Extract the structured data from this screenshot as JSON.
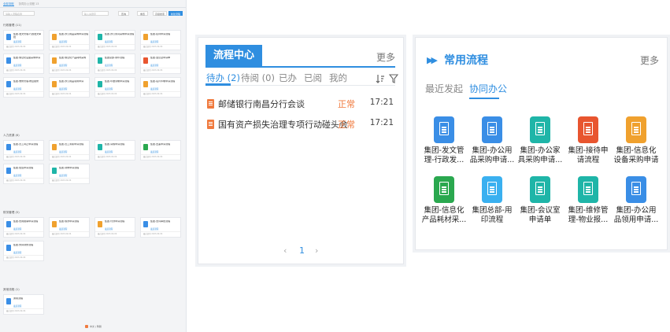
{
  "left_panel": {
    "tabs": [
      "全部流程",
      "协同办公流程 13"
    ],
    "search_placeholder": "请输入流程名称",
    "search2_placeholder": "输入关键字",
    "btn_query": "查询",
    "btn_reset": "重置",
    "btn_advanced": "高级搜索",
    "btn_new": "新建流程",
    "sections": [
      {
        "title": "行政管理 (11)",
        "cards": [
          {
            "title": "集团-发文管理-行政发文审批",
            "color": "#3a8ee6"
          },
          {
            "title": "集团-办公用品采购申请流程",
            "color": "#f0a12e"
          },
          {
            "title": "集团-办公家具采购申请流程",
            "color": "#1fb5a8"
          },
          {
            "title": "集团-接待申请流程",
            "color": "#f0a12e"
          },
          {
            "title": "集团-信息化设备采购申请",
            "color": "#3a8ee6"
          },
          {
            "title": "集团-信息化产品耗材采购",
            "color": "#f0a12e"
          },
          {
            "title": "集团总部-用印流程",
            "color": "#1fb5a8"
          },
          {
            "title": "集团-会议室申请单",
            "color": "#e8552f"
          },
          {
            "title": "集团-维修管理-物业报修",
            "color": "#3a8ee6"
          },
          {
            "title": "集团-办公用品领用申请",
            "color": "#f0a12e"
          },
          {
            "title": "集团-印章刻制申请流程",
            "color": "#1fb5a8"
          },
          {
            "title": "集团-名片印制申请流程",
            "color": "#f0a12e"
          }
        ]
      },
      {
        "title": "人力资源 (6)",
        "cards": [
          {
            "title": "集团-员工转正申请流程",
            "color": "#3a8ee6"
          },
          {
            "title": "集团-员工离职申请流程",
            "color": "#f0a12e"
          },
          {
            "title": "集团-请假申请流程",
            "color": "#1fb5a8"
          },
          {
            "title": "集团-出差申请流程",
            "color": "#2aa84f"
          },
          {
            "title": "集团-加班申请流程",
            "color": "#3a8ee6"
          },
          {
            "title": "集团-调岗申请流程",
            "color": "#1fb5a8"
          }
        ]
      },
      {
        "title": "财务管理 (5)",
        "cards": [
          {
            "title": "集团-费用报销申请流程",
            "color": "#3a8ee6"
          },
          {
            "title": "集团-借款申请流程",
            "color": "#f0a12e"
          },
          {
            "title": "集团-付款申请流程",
            "color": "#f0a12e"
          },
          {
            "title": "集团-合同审批流程",
            "color": "#3a8ee6"
          },
          {
            "title": "集团-预算调整流程",
            "color": "#3a8ee6"
          }
        ]
      },
      {
        "title": "其他流程 (1)",
        "cards": [
          {
            "title": "通用流程",
            "color": "#3a8ee6"
          }
        ]
      }
    ],
    "card_link": "发起流程",
    "card_footer": "最近使用 2023-09-06",
    "footer_text": "中文 | 繁體"
  },
  "process_center": {
    "title": "流程中心",
    "more": "更多",
    "tabs": [
      "待办 (2)",
      "待阅 (0)",
      "已办",
      "已阅",
      "我的"
    ],
    "rows": [
      {
        "title": "邮储银行南昌分行会谈",
        "status": "正常",
        "time": "17:21"
      },
      {
        "title": "国有资产损失治理专项行动碰头会",
        "status": "正常",
        "time": "17:21"
      }
    ],
    "page": "1"
  },
  "common_process": {
    "title": "常用流程",
    "more": "更多",
    "tab_recent": "最近发起",
    "tab_collab": "协同办公",
    "apps": [
      {
        "label": "集团-发文管理-行政发...",
        "color": "#3a8ee6"
      },
      {
        "label": "集团-办公用品采购申请...",
        "color": "#3a8ee6"
      },
      {
        "label": "集团-办公家具采购申请...",
        "color": "#1fb5a8"
      },
      {
        "label": "集团-接待申请流程",
        "color": "#e8552f"
      },
      {
        "label": "集团-信息化设备采购申请",
        "color": "#f0a12e"
      },
      {
        "label": "集团-信息化产品耗材采...",
        "color": "#2aa84f"
      },
      {
        "label": "集团总部-用印流程",
        "color": "#3ab0f0"
      },
      {
        "label": "集团-会议室申请单",
        "color": "#1fb5a8"
      },
      {
        "label": "集团-维修管理-物业报...",
        "color": "#1fb5a8"
      },
      {
        "label": "集团-办公用品领用申请...",
        "color": "#3a8ee6"
      }
    ]
  }
}
